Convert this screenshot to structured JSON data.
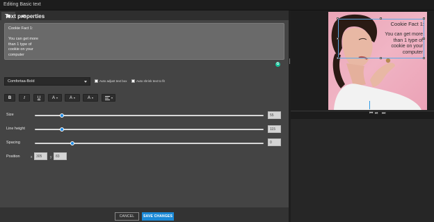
{
  "window": {
    "title": "Editing Basic text"
  },
  "tabs": [
    {
      "name": "text-tab",
      "icon": "speech-bubble-icon"
    },
    {
      "name": "style-tab",
      "icon": "layers-icon"
    }
  ],
  "panel": {
    "heading": "Text properties",
    "text_value": "Cookie Fact 1:\n\nYou can get more\nthan 1 type of\ncookie on your\ncomputer",
    "font": "Comfortaa-Bold",
    "auto_adjust_label": "Auto adjust text box",
    "auto_shrink_label": "Auto shrink text to fit",
    "auto_adjust_checked": false,
    "auto_shrink_checked": false,
    "format": {
      "bold": "B",
      "italic": "I",
      "underline": "U",
      "font_color": "A",
      "highlight": "A",
      "text_bg": "A"
    },
    "size": {
      "label": "Size",
      "value": "55",
      "fraction": 0.12
    },
    "line_height": {
      "label": "Line height",
      "value": "115",
      "fraction": 0.12
    },
    "spacing": {
      "label": "Spacing",
      "value": "0",
      "fraction": 0.165
    },
    "position": {
      "label": "Position",
      "x_label": "x",
      "x": "305",
      "y_label": "y",
      "y": "83"
    }
  },
  "footer": {
    "cancel": "CANCEL",
    "save": "SAVE CHANGES"
  },
  "preview": {
    "caption_title": "Cookie Fact 1:",
    "caption_body": "You can get more\nthan 1 type of\ncookie on your\ncomputer",
    "accent": "#1f8ce6"
  }
}
